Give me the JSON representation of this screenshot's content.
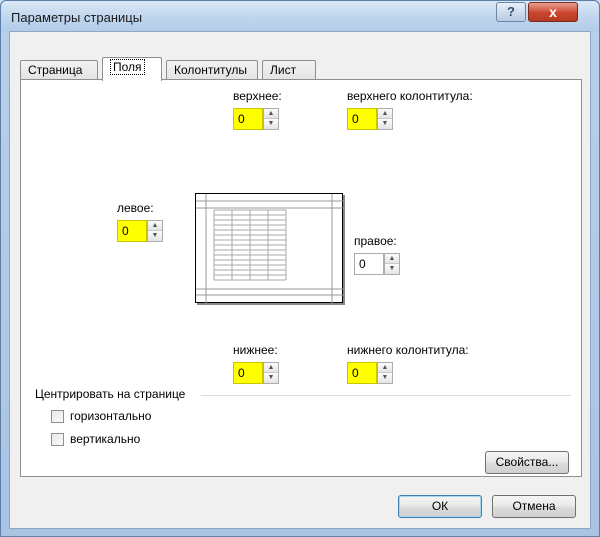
{
  "window": {
    "title": "Параметры страницы",
    "help_label": "?",
    "close_label": "x"
  },
  "tabs": [
    {
      "label": "Страница"
    },
    {
      "label": "Поля",
      "active": true
    },
    {
      "label": "Колонтитулы"
    },
    {
      "label": "Лист"
    }
  ],
  "margins": {
    "top": {
      "label": "верхнее:",
      "value": "0"
    },
    "header": {
      "label": "верхнего колонтитула:",
      "value": "0"
    },
    "left": {
      "label": "левое:",
      "value": "0"
    },
    "right": {
      "label": "правое:",
      "value": "0"
    },
    "bottom": {
      "label": "нижнее:",
      "value": "0"
    },
    "footer": {
      "label": "нижнего колонтитула:",
      "value": "0"
    }
  },
  "center": {
    "group_label": "Центрировать на странице",
    "horizontal": {
      "label": "горизонтально",
      "checked": false
    },
    "vertical": {
      "label": "вертикально",
      "checked": false
    }
  },
  "buttons": {
    "properties": "Свойства...",
    "ok": "ОК",
    "cancel": "Отмена"
  },
  "colors": {
    "highlight": "#ffff00",
    "titlebar": "#c2d7ef",
    "close_button": "#c9462c"
  }
}
